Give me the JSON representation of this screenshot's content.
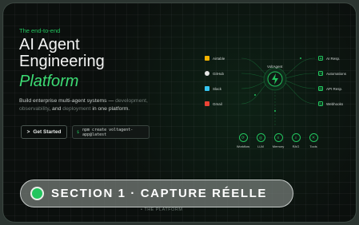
{
  "hero": {
    "eyebrow": "The end-to-end",
    "title_line1": "AI Agent",
    "title_line2": "Engineering",
    "title_line3": "Platform",
    "desc_a": "Build enterprise multi-agent systems — ",
    "desc_b": "development, observability",
    "desc_c": ", and ",
    "desc_d": "deployment",
    "desc_e": " in one platform.",
    "get_started_icon": ">",
    "get_started_label": "Get Started",
    "command_prompt": "$",
    "command": "npm create voltagent-app@latest"
  },
  "diagram": {
    "hub_label": "VoltAgent",
    "inputs": [
      {
        "label": "Airtable",
        "icon": "airtable-icon",
        "color": "#f4b400"
      },
      {
        "label": "GitHub",
        "icon": "github-icon",
        "color": "#e6e6e6"
      },
      {
        "label": "Slack",
        "icon": "slack-icon",
        "color": "#36c5f0"
      },
      {
        "label": "Gmail",
        "icon": "gmail-icon",
        "color": "#ea4335"
      }
    ],
    "outputs": [
      {
        "label": "AI Resp.",
        "icon": "sparkle-icon",
        "glyph": "✦"
      },
      {
        "label": "Automations",
        "icon": "clock-icon",
        "glyph": "◷"
      },
      {
        "label": "API Resp.",
        "icon": "document-icon",
        "glyph": "▤"
      },
      {
        "label": "Webhooks",
        "icon": "refresh-icon",
        "glyph": "↻"
      }
    ],
    "tools": [
      {
        "label": "Workflow",
        "icon": "workflow-icon",
        "glyph": "⟳"
      },
      {
        "label": "LLM",
        "icon": "brain-icon",
        "glyph": "◎"
      },
      {
        "label": "Memory",
        "icon": "database-icon",
        "glyph": "≡"
      },
      {
        "label": "RAG",
        "icon": "search-icon",
        "glyph": "⌕"
      },
      {
        "label": "Tools",
        "icon": "wrench-icon",
        "glyph": "✕"
      }
    ]
  },
  "badge": {
    "label": "SECTION 1 · CAPTURE RÉELLE",
    "under_text": "• THE PLATFORM"
  },
  "colors": {
    "accent": "#22c55e",
    "background": "#0b0f0d"
  }
}
